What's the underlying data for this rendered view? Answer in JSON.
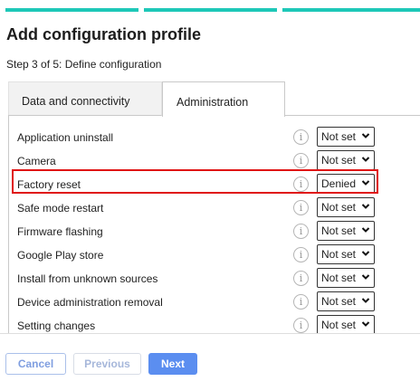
{
  "wizard": {
    "title": "Add configuration profile",
    "step_text": "Step 3 of 5: Define configuration",
    "progress_segments": 3
  },
  "tabs": [
    {
      "label": "Data and connectivity",
      "active": false
    },
    {
      "label": "Administration",
      "active": true
    }
  ],
  "settings": [
    {
      "label": "Application uninstall",
      "value": "Not set"
    },
    {
      "label": "Camera",
      "value": "Not set"
    },
    {
      "label": "Factory reset",
      "value": "Denied",
      "highlighted": true
    },
    {
      "label": "Safe mode restart",
      "value": "Not set"
    },
    {
      "label": "Firmware flashing",
      "value": "Not set"
    },
    {
      "label": "Google Play store",
      "value": "Not set"
    },
    {
      "label": "Install from unknown sources",
      "value": "Not set"
    },
    {
      "label": "Device administration removal",
      "value": "Not set"
    },
    {
      "label": "Setting changes",
      "value": "Not set"
    }
  ],
  "info_glyph": "i",
  "buttons": {
    "cancel": "Cancel",
    "previous": "Previous",
    "next": "Next"
  },
  "colors": {
    "progress": "#1ec8b8",
    "highlight": "#e01414",
    "primary": "#5b8ef0"
  }
}
